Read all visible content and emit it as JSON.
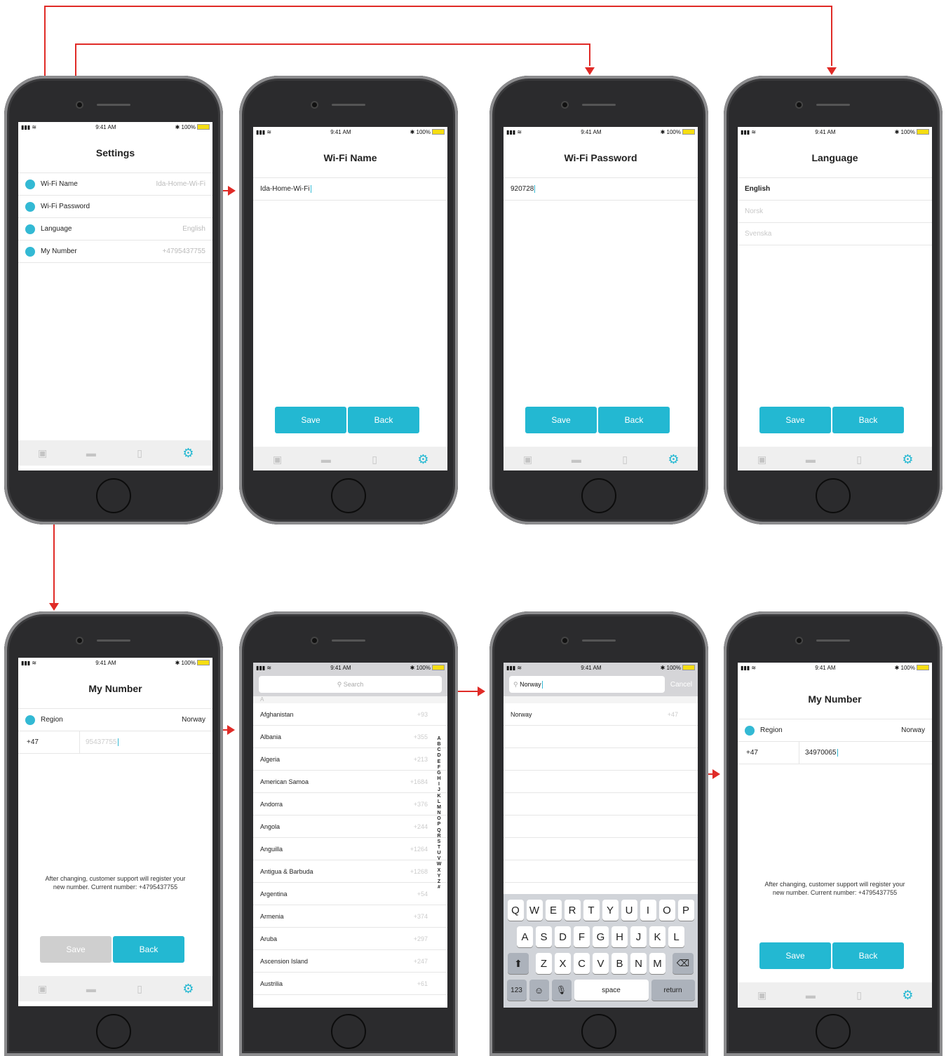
{
  "status": {
    "time": "9:41 AM",
    "battery": "100%"
  },
  "settings": {
    "title": "Settings",
    "items": [
      {
        "label": "Wi-Fi Name",
        "value": "Ida-Home-Wi-Fi"
      },
      {
        "label": "Wi-Fi Password",
        "value": ""
      },
      {
        "label": "Language",
        "value": "English"
      },
      {
        "label": "My Number",
        "value": "+4795437755"
      }
    ]
  },
  "wifi_name": {
    "title": "Wi-Fi Name",
    "value": "Ida-Home-Wi-Fi"
  },
  "wifi_password": {
    "title": "Wi-Fi Password",
    "value": "920728"
  },
  "language": {
    "title": "Language",
    "options": [
      "English",
      "Norsk",
      "Svenska"
    ]
  },
  "buttons": {
    "save": "Save",
    "back": "Back"
  },
  "my_number": {
    "title": "My Number",
    "region_label": "Region",
    "region_value": "Norway",
    "prefix": "+47",
    "placeholder": "95437755",
    "new_value": "34970065",
    "note": "After changing, customer support will register your new number. Current number: +4795437755"
  },
  "country_picker": {
    "search_placeholder": "Search",
    "section": "A",
    "countries": [
      {
        "name": "Afghanistan",
        "code": "+93"
      },
      {
        "name": "Albania",
        "code": "+355"
      },
      {
        "name": "Algeria",
        "code": "+213"
      },
      {
        "name": "American Samoa",
        "code": "+1684"
      },
      {
        "name": "Andorra",
        "code": "+376"
      },
      {
        "name": "Angola",
        "code": "+244"
      },
      {
        "name": "Anguilla",
        "code": "+1264"
      },
      {
        "name": "Antigua & Barbuda",
        "code": "+1268"
      },
      {
        "name": "Argentina",
        "code": "+54"
      },
      {
        "name": "Armenia",
        "code": "+374"
      },
      {
        "name": "Aruba",
        "code": "+297"
      },
      {
        "name": "Ascension Island",
        "code": "+247"
      },
      {
        "name": "Austrilia",
        "code": "+61"
      }
    ],
    "alphabet": [
      "A",
      "B",
      "C",
      "D",
      "E",
      "F",
      "G",
      "H",
      "I",
      "J",
      "K",
      "L",
      "M",
      "N",
      "O",
      "P",
      "Q",
      "R",
      "S",
      "T",
      "U",
      "V",
      "W",
      "X",
      "Y",
      "Z",
      "#"
    ]
  },
  "country_search": {
    "query": "Norway",
    "cancel": "Cancel",
    "result": {
      "name": "Norway",
      "code": "+47"
    }
  },
  "keyboard": {
    "row1": [
      "Q",
      "W",
      "E",
      "R",
      "T",
      "Y",
      "U",
      "I",
      "O",
      "P"
    ],
    "row2": [
      "A",
      "S",
      "D",
      "F",
      "G",
      "H",
      "J",
      "K",
      "L"
    ],
    "row3": [
      "Z",
      "X",
      "C",
      "V",
      "B",
      "N",
      "M"
    ],
    "numbers": "123",
    "space": "space",
    "return": "return"
  },
  "tabs": [
    "robot-icon",
    "router-icon",
    "phone-icon",
    "gear-icon"
  ],
  "colors": {
    "accent": "#23b8d2",
    "arrow": "#e02b27",
    "disabled": "#cfcfcf"
  }
}
